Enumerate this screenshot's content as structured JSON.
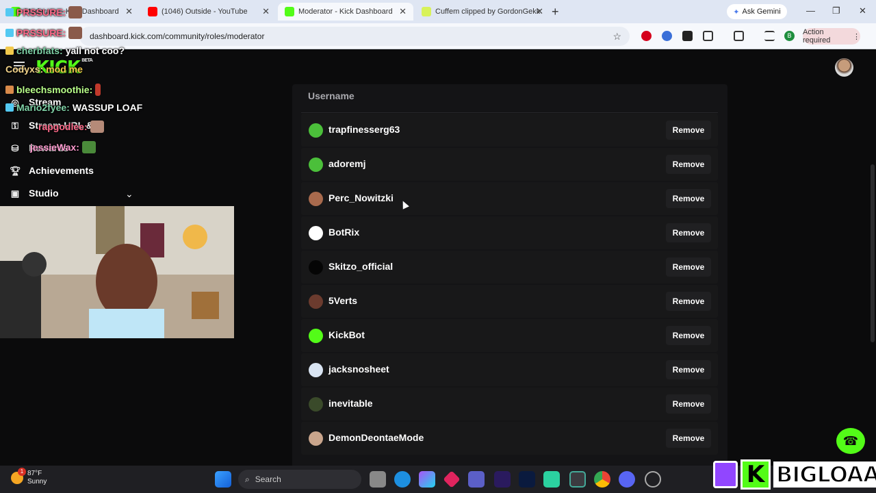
{
  "browser": {
    "tabs": [
      {
        "title": "Moderator - Kick Dashboard"
      },
      {
        "title": "(1046) Outside - YouTube"
      },
      {
        "title": "Moderator - Kick Dashboard"
      },
      {
        "title": "Cuffem clipped by GordonGekk"
      }
    ],
    "new_tab": "+",
    "ask_gemini": "Ask Gemini",
    "url": "dashboard.kick.com/community/roles/moderator",
    "action_required": "Action required",
    "profile_letter": "B"
  },
  "sidebar": {
    "logo": "KICK",
    "logo_badge": "BETA",
    "items": [
      {
        "label": "Stream"
      },
      {
        "label": "Stream URL &"
      },
      {
        "label": "Rewards"
      },
      {
        "label": "Achievements"
      },
      {
        "label": "Studio"
      }
    ]
  },
  "chat_overlay": [
    {
      "user": "PRSSURE:",
      "text": "",
      "color": "#ff6b8b"
    },
    {
      "user": "PRSSURE:",
      "text": "",
      "color": "#ff6b8b"
    },
    {
      "user": "cherbfats:",
      "text": "yall not coo?",
      "color": "#7fd2a7"
    },
    {
      "user": "Codyxs:",
      "text": "mod me",
      "color": "#ffffff"
    },
    {
      "user": "bleechsmoothie:",
      "text": "",
      "color": "#b9ff8a"
    },
    {
      "user": "Mario2fyee:",
      "text": "WASSUP LOAF",
      "color": "#7fd2a7"
    },
    {
      "user": "rapgodlee:",
      "text": "",
      "color": "#ff6b8b"
    },
    {
      "user": "jessieWax:",
      "text": "",
      "color": "#ff9bd0"
    }
  ],
  "moderators": {
    "column_header": "Username",
    "remove_label": "Remove",
    "rows": [
      {
        "username": "trapfinesserg63",
        "avatar_color": "#4bbf3a"
      },
      {
        "username": "adoremj",
        "avatar_color": "#4bbf3a"
      },
      {
        "username": "Perc_Nowitzki",
        "avatar_color": "#a86a4d"
      },
      {
        "username": "BotRix",
        "avatar_color": "#ffffff"
      },
      {
        "username": "Skitzo_official",
        "avatar_color": "#050505"
      },
      {
        "username": "5Verts",
        "avatar_color": "#6b3b2e"
      },
      {
        "username": "KickBot",
        "avatar_color": "#53fc18"
      },
      {
        "username": "jacksnosheet",
        "avatar_color": "#d9e4f2"
      },
      {
        "username": "inevitable",
        "avatar_color": "#3a4a2a"
      },
      {
        "username": "DemonDeontaeMode",
        "avatar_color": "#c9a58c"
      }
    ]
  },
  "taskbar": {
    "weather_temp": "87°F",
    "weather_desc": "Sunny",
    "weather_badge": "1",
    "search_placeholder": "Search"
  },
  "branding": {
    "k_letter": "K",
    "name": "BIGLOAAF"
  },
  "colors": {
    "kick_green": "#53fc18",
    "row_bg": "#181819",
    "card_bg": "#141416"
  }
}
